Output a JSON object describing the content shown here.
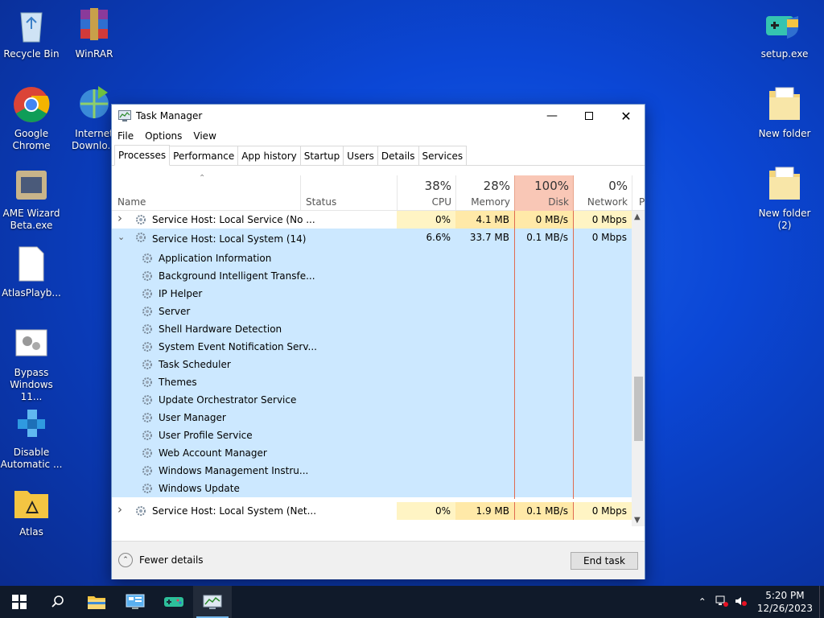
{
  "desktop": {
    "left_icons": [
      {
        "label": "Recycle Bin",
        "icon": "recycle-bin-icon"
      },
      {
        "label": "WinRAR",
        "icon": "winrar-icon"
      },
      {
        "label": "Google\nChrome",
        "icon": "chrome-icon"
      },
      {
        "label": "Internet\nDownlo...",
        "icon": "internet-download-icon"
      },
      {
        "label": "AME Wizard\nBeta.exe",
        "icon": "ame-wizard-icon"
      },
      {
        "label": "AtlasPlayb...",
        "icon": "file-icon"
      },
      {
        "label": "Bypass\nWindows 11...",
        "icon": "settings-file-icon"
      },
      {
        "label": "Disable\nAutomatic ...",
        "icon": "cubes-icon"
      },
      {
        "label": "Atlas",
        "icon": "folder-atlas-icon"
      }
    ],
    "right_icons": [
      {
        "label": "setup.exe",
        "icon": "setup-icon"
      },
      {
        "label": "New folder",
        "icon": "folder-icon"
      },
      {
        "label": "New folder\n(2)",
        "icon": "folder-icon"
      }
    ]
  },
  "taskmanager": {
    "title": "Task Manager",
    "menu": [
      "File",
      "Options",
      "View"
    ],
    "tabs": [
      "Processes",
      "Performance",
      "App history",
      "Startup",
      "Users",
      "Details",
      "Services"
    ],
    "active_tab": "Processes",
    "columns": {
      "name": "Name",
      "status": "Status",
      "cpu": {
        "pct": "38%",
        "label": "CPU"
      },
      "memory": {
        "pct": "28%",
        "label": "Memory"
      },
      "disk": {
        "pct": "100%",
        "label": "Disk"
      },
      "network": {
        "pct": "0%",
        "label": "Network"
      },
      "power": "P"
    },
    "rows": [
      {
        "type": "group",
        "expanded": false,
        "name": "Service Host: Local Service (No ...",
        "cpu": "0%",
        "memory": "4.1 MB",
        "disk": "0 MB/s",
        "network": "0 Mbps"
      },
      {
        "type": "group",
        "expanded": true,
        "name": "Service Host: Local System (14)",
        "cpu": "6.6%",
        "memory": "33.7 MB",
        "disk": "0.1 MB/s",
        "network": "0 Mbps"
      },
      {
        "type": "child",
        "name": "Application Information"
      },
      {
        "type": "child",
        "name": "Background Intelligent Transfe..."
      },
      {
        "type": "child",
        "name": "IP Helper"
      },
      {
        "type": "child",
        "name": "Server"
      },
      {
        "type": "child",
        "name": "Shell Hardware Detection"
      },
      {
        "type": "child",
        "name": "System Event Notification Serv..."
      },
      {
        "type": "child",
        "name": "Task Scheduler"
      },
      {
        "type": "child",
        "name": "Themes"
      },
      {
        "type": "child",
        "name": "Update Orchestrator Service"
      },
      {
        "type": "child",
        "name": "User Manager"
      },
      {
        "type": "child",
        "name": "User Profile Service"
      },
      {
        "type": "child",
        "name": "Web Account Manager"
      },
      {
        "type": "child",
        "name": "Windows Management Instru..."
      },
      {
        "type": "child",
        "name": "Windows Update"
      },
      {
        "type": "group",
        "expanded": false,
        "name": "Service Host: Local System (Net...",
        "cpu": "0%",
        "memory": "1.9 MB",
        "disk": "0.1 MB/s",
        "network": "0 Mbps"
      }
    ],
    "fewer_details": "Fewer details",
    "end_task": "End task"
  },
  "taskbar": {
    "time": "5:20 PM",
    "date": "12/26/2023"
  },
  "colors": {
    "selection": "#cce8ff",
    "disk_header": "#f9c7b6",
    "heat_light": "#fff4c4",
    "heat_mid": "#ffe9a8"
  }
}
